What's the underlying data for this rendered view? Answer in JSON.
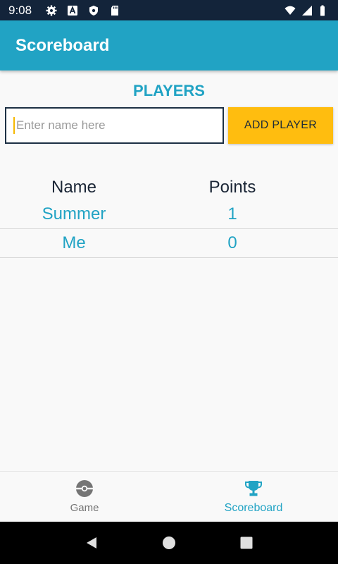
{
  "status_bar": {
    "time": "9:08",
    "icons_left": [
      "settings-icon",
      "text-a-icon",
      "shield-icon",
      "sd-card-icon"
    ],
    "icons_right": [
      "wifi-icon",
      "signal-icon",
      "battery-icon"
    ]
  },
  "app_bar": {
    "title": "Scoreboard"
  },
  "players": {
    "heading": "PLAYERS",
    "input_placeholder": "Enter name here",
    "add_button_label": "ADD PLAYER"
  },
  "scoreboard_table": {
    "headers": {
      "name": "Name",
      "points": "Points"
    },
    "rows": [
      {
        "name": "Summer",
        "points": "1"
      },
      {
        "name": "Me",
        "points": "0"
      }
    ]
  },
  "bottom_nav": {
    "items": [
      {
        "label": "Game",
        "icon": "pokeball-icon",
        "active": false
      },
      {
        "label": "Scoreboard",
        "icon": "trophy-icon",
        "active": true
      }
    ]
  },
  "colors": {
    "primary": "#21a3c4",
    "accent": "#ffbd0f",
    "status_bar": "#13243a",
    "inactive": "#757575"
  },
  "system_nav": [
    "back-icon",
    "home-icon",
    "recents-icon"
  ]
}
